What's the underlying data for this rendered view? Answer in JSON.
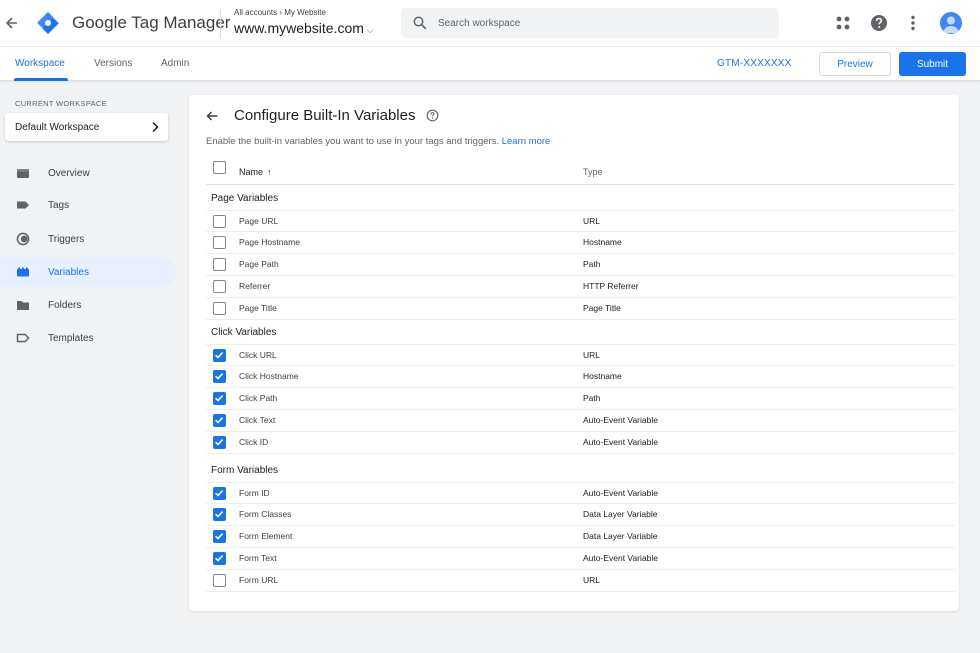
{
  "app": {
    "title": "Google Tag Manager",
    "breadcrumb_root": "All accounts",
    "breadcrumb_account": "My Website",
    "container_name": "www.mywebsite.com"
  },
  "search": {
    "placeholder": "Search workspace",
    "value": ""
  },
  "tabs": [
    {
      "label": "Workspace",
      "active": true
    },
    {
      "label": "Versions",
      "active": false
    },
    {
      "label": "Admin",
      "active": false
    }
  ],
  "header": {
    "container_id": "GTM-XXXXXXX",
    "preview_label": "Preview",
    "submit_label": "Submit"
  },
  "sidebar": {
    "caption": "CURRENT WORKSPACE",
    "workspace_name": "Default Workspace",
    "items": [
      {
        "label": "Overview",
        "icon": "overview-icon",
        "active": false
      },
      {
        "label": "Tags",
        "icon": "tag-icon",
        "active": false
      },
      {
        "label": "Triggers",
        "icon": "trigger-icon",
        "active": false
      },
      {
        "label": "Variables",
        "icon": "variables-icon",
        "active": true
      },
      {
        "label": "Folders",
        "icon": "folder-icon",
        "active": false
      },
      {
        "label": "Templates",
        "icon": "template-icon",
        "active": false
      }
    ]
  },
  "panel": {
    "title": "Configure Built-In Variables",
    "description": "Enable the built-in variables you want to use in your tags and triggers.",
    "learn_more": "Learn more",
    "col_name": "Name",
    "col_type": "Type",
    "sections": [
      {
        "title": "Page Variables",
        "rows": [
          {
            "name": "Page URL",
            "type": "URL",
            "checked": false
          },
          {
            "name": "Page Hostname",
            "type": "Hostname",
            "checked": false
          },
          {
            "name": "Page Path",
            "type": "Path",
            "checked": false
          },
          {
            "name": "Referrer",
            "type": "HTTP Referrer",
            "checked": false
          },
          {
            "name": "Page Title",
            "type": "Page Title",
            "checked": false
          }
        ]
      },
      {
        "title": "Click Variables",
        "rows": [
          {
            "name": "Click URL",
            "type": "URL",
            "checked": true
          },
          {
            "name": "Click Hostname",
            "type": "Hostname",
            "checked": true
          },
          {
            "name": "Click Path",
            "type": "Path",
            "checked": true
          },
          {
            "name": "Click Text",
            "type": "Auto-Event Variable",
            "checked": true
          },
          {
            "name": "Click ID",
            "type": "Auto-Event Variable",
            "checked": true
          }
        ]
      },
      {
        "title": "Form Variables",
        "rows": [
          {
            "name": "Form ID",
            "type": "Auto-Event Variable",
            "checked": true
          },
          {
            "name": "Form Classes",
            "type": "Data Layer Variable",
            "checked": true
          },
          {
            "name": "Form Element",
            "type": "Data Layer Variable",
            "checked": true
          },
          {
            "name": "Form Text",
            "type": "Auto-Event Variable",
            "checked": true
          },
          {
            "name": "Form URL",
            "type": "URL",
            "checked": false
          }
        ]
      }
    ]
  },
  "colors": {
    "accent": "#1a73e8",
    "active_bg": "#e8f0fe"
  }
}
